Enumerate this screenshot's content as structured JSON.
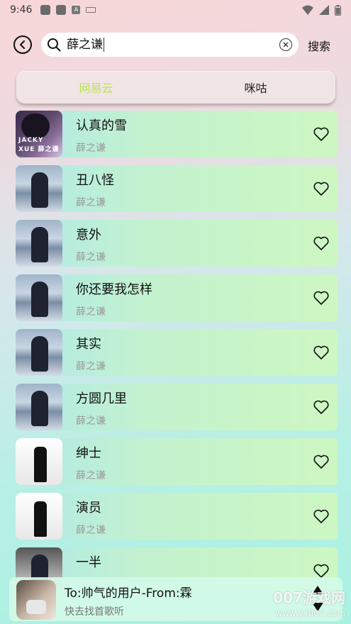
{
  "status_bar": {
    "time": "9:46",
    "icons": [
      "app-icon",
      "app-icon",
      "a-icon",
      "keyboard-icon",
      "wifi-icon",
      "signal-icon",
      "battery-icon"
    ]
  },
  "search": {
    "query": "薛之谦",
    "submit_label": "搜索"
  },
  "tabs": [
    {
      "label": "网易云",
      "active": true
    },
    {
      "label": "咪咕",
      "active": false
    }
  ],
  "songs": [
    {
      "title": "认真的雪",
      "artist": "薛之谦",
      "album_text": "JACKY XUE 薛之谦"
    },
    {
      "title": "丑八怪",
      "artist": "薛之谦"
    },
    {
      "title": "意外",
      "artist": "薛之谦"
    },
    {
      "title": "你还要我怎样",
      "artist": "薛之谦"
    },
    {
      "title": "其实",
      "artist": "薛之谦"
    },
    {
      "title": "方圆几里",
      "artist": "薛之谦"
    },
    {
      "title": "绅士",
      "artist": "薛之谦"
    },
    {
      "title": "演员",
      "artist": "薛之谦"
    },
    {
      "title": "一半",
      "artist": ""
    }
  ],
  "player": {
    "title": "To:帅气的用户-From:霖",
    "subtitle": "快去找首歌听"
  },
  "watermark": {
    "main": "007游戏网",
    "sub": "www.yx007.com"
  },
  "colors": {
    "active_tab": "#b8e84e",
    "row_gradient_start": "#b0e9e8",
    "row_gradient_end": "#cdf7c2"
  }
}
